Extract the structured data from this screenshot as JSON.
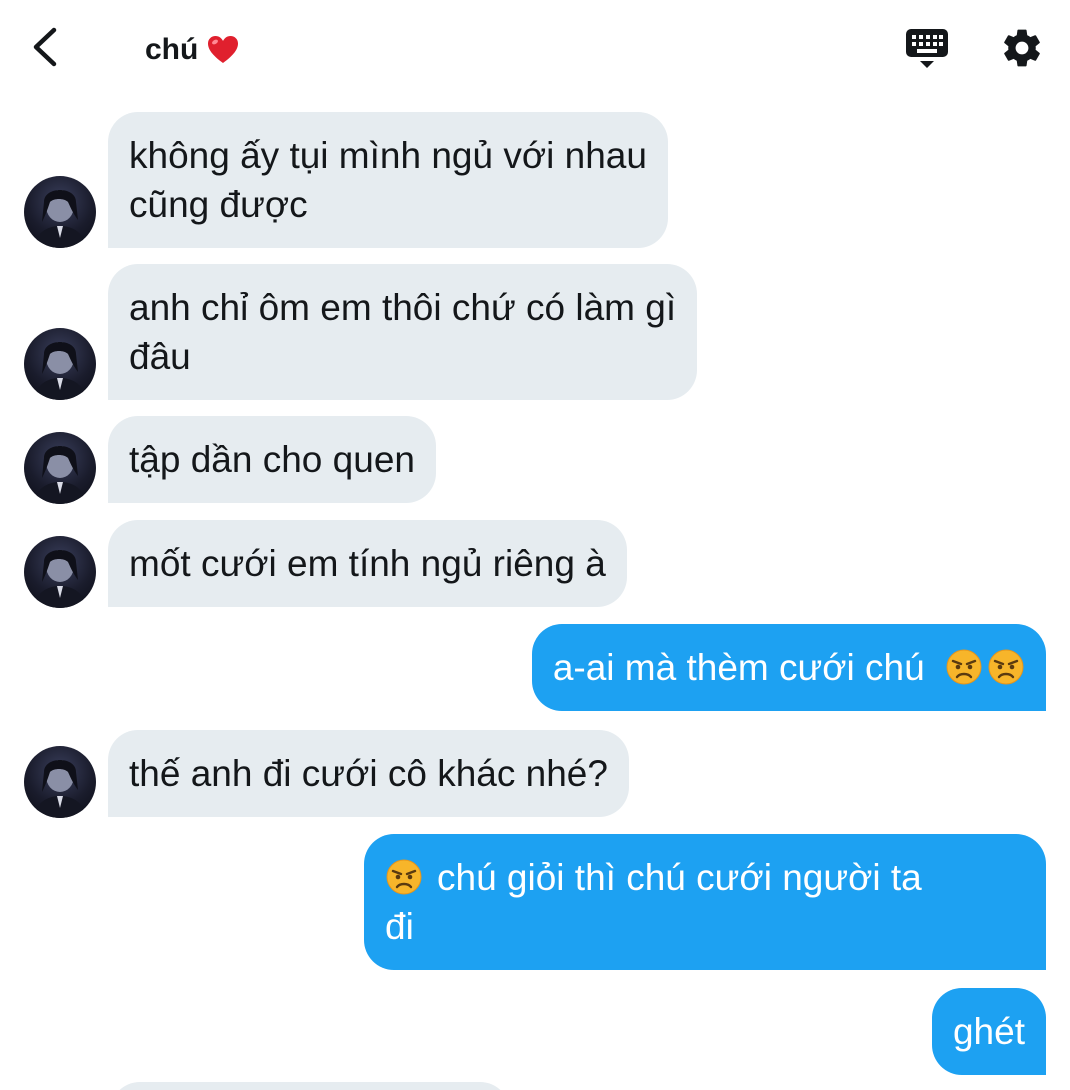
{
  "header": {
    "title": "chú",
    "back_icon": "chevron-left-icon",
    "heart_icon": "red-heart-emoji",
    "keyboard_icon": "keyboard-icon",
    "settings_icon": "gear-icon"
  },
  "colors": {
    "incoming_bubble": "#e6ecf0",
    "outgoing_bubble": "#1da1f2",
    "text_dark": "#14171a"
  },
  "messages": [
    {
      "direction": "in",
      "lines": [
        "không ấy tụi mình ngủ với nhau",
        "cũng được"
      ]
    },
    {
      "direction": "in",
      "lines": [
        "anh chỉ ôm em thôi chứ có làm gì",
        "đâu"
      ]
    },
    {
      "direction": "in",
      "lines": [
        "tập dần cho quen"
      ]
    },
    {
      "direction": "in",
      "lines": [
        "mốt cưới em tính ngủ riêng à"
      ]
    },
    {
      "direction": "out",
      "text": "a-ai mà thèm cưới chú",
      "emoji": "angry-face-emoji"
    },
    {
      "direction": "in",
      "lines": [
        "thế anh đi cưới cô khác nhé?"
      ]
    },
    {
      "direction": "out",
      "lines": [
        "chú giỏi thì chú cưới người ta",
        "đi"
      ],
      "emoji": "angry-face-emoji"
    },
    {
      "direction": "out",
      "lines": [
        "ghét"
      ]
    }
  ]
}
